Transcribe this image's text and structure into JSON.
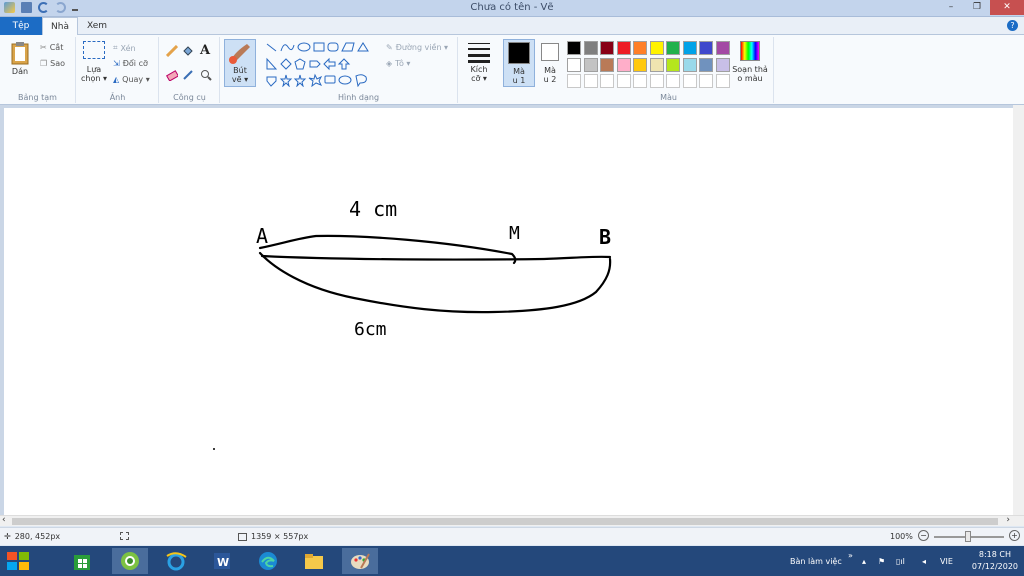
{
  "window": {
    "title": "Chưa có tên - Vẽ",
    "controls": {
      "minimize": "–",
      "maximize": "❐",
      "close": "✕"
    }
  },
  "tabs": {
    "file": "Tệp",
    "home": "Nhà",
    "view": "Xem",
    "help": "?"
  },
  "ribbon": {
    "clipboard": {
      "label": "Bảng tạm",
      "paste": "Dán",
      "cut": "Cắt",
      "copy": "Sao"
    },
    "image": {
      "label": "Ảnh",
      "select_line1": "Lựa",
      "select_line2": "chọn ▾",
      "crop": "Xén",
      "resize": "Đổi cỡ",
      "rotate": "Quay ▾"
    },
    "tools": {
      "label": "Công cụ",
      "text_icon": "A"
    },
    "brushes": {
      "line1": "Bút",
      "line2": "vẽ ▾"
    },
    "shapes": {
      "label": "Hình dạng",
      "outline": "Đường viền ▾",
      "fill": "Tô ▾"
    },
    "size": {
      "line1": "Kích",
      "line2": "cỡ ▾"
    },
    "color1": {
      "line1": "Mà",
      "line2": "u 1"
    },
    "color2": {
      "line1": "Mà",
      "line2": "u 2"
    },
    "colors": {
      "label": "Màu",
      "edit_line1": "Soạn thả",
      "edit_line2": "o màu",
      "palette_row1": [
        "#000000",
        "#7f7f7f",
        "#880015",
        "#ed1c24",
        "#ff7f27",
        "#fff200",
        "#22b14c",
        "#00a2e8",
        "#3f48cc",
        "#a349a4"
      ],
      "palette_row2": [
        "#ffffff",
        "#c3c3c3",
        "#b97a57",
        "#ffaec9",
        "#ffc90e",
        "#efe4b0",
        "#b5e61d",
        "#99d9ea",
        "#7092be",
        "#c8bfe7"
      ],
      "color1_value": "#000000",
      "color2_value": "#ffffff"
    }
  },
  "drawing": {
    "label_a": "A",
    "label_m": "M",
    "label_b": "B",
    "label_top": "4 cm",
    "label_bottom": "6cm"
  },
  "status": {
    "cursor_pos": "280, 452px",
    "canvas_size": "1359 × 557px",
    "zoom": "100%",
    "zoom_minus": "−",
    "zoom_plus": "+"
  },
  "taskbar": {
    "desktop_label": "Bàn làm việc",
    "chevron": "»",
    "language": "VIE",
    "time": "8:18 CH",
    "date": "07/12/2020"
  }
}
